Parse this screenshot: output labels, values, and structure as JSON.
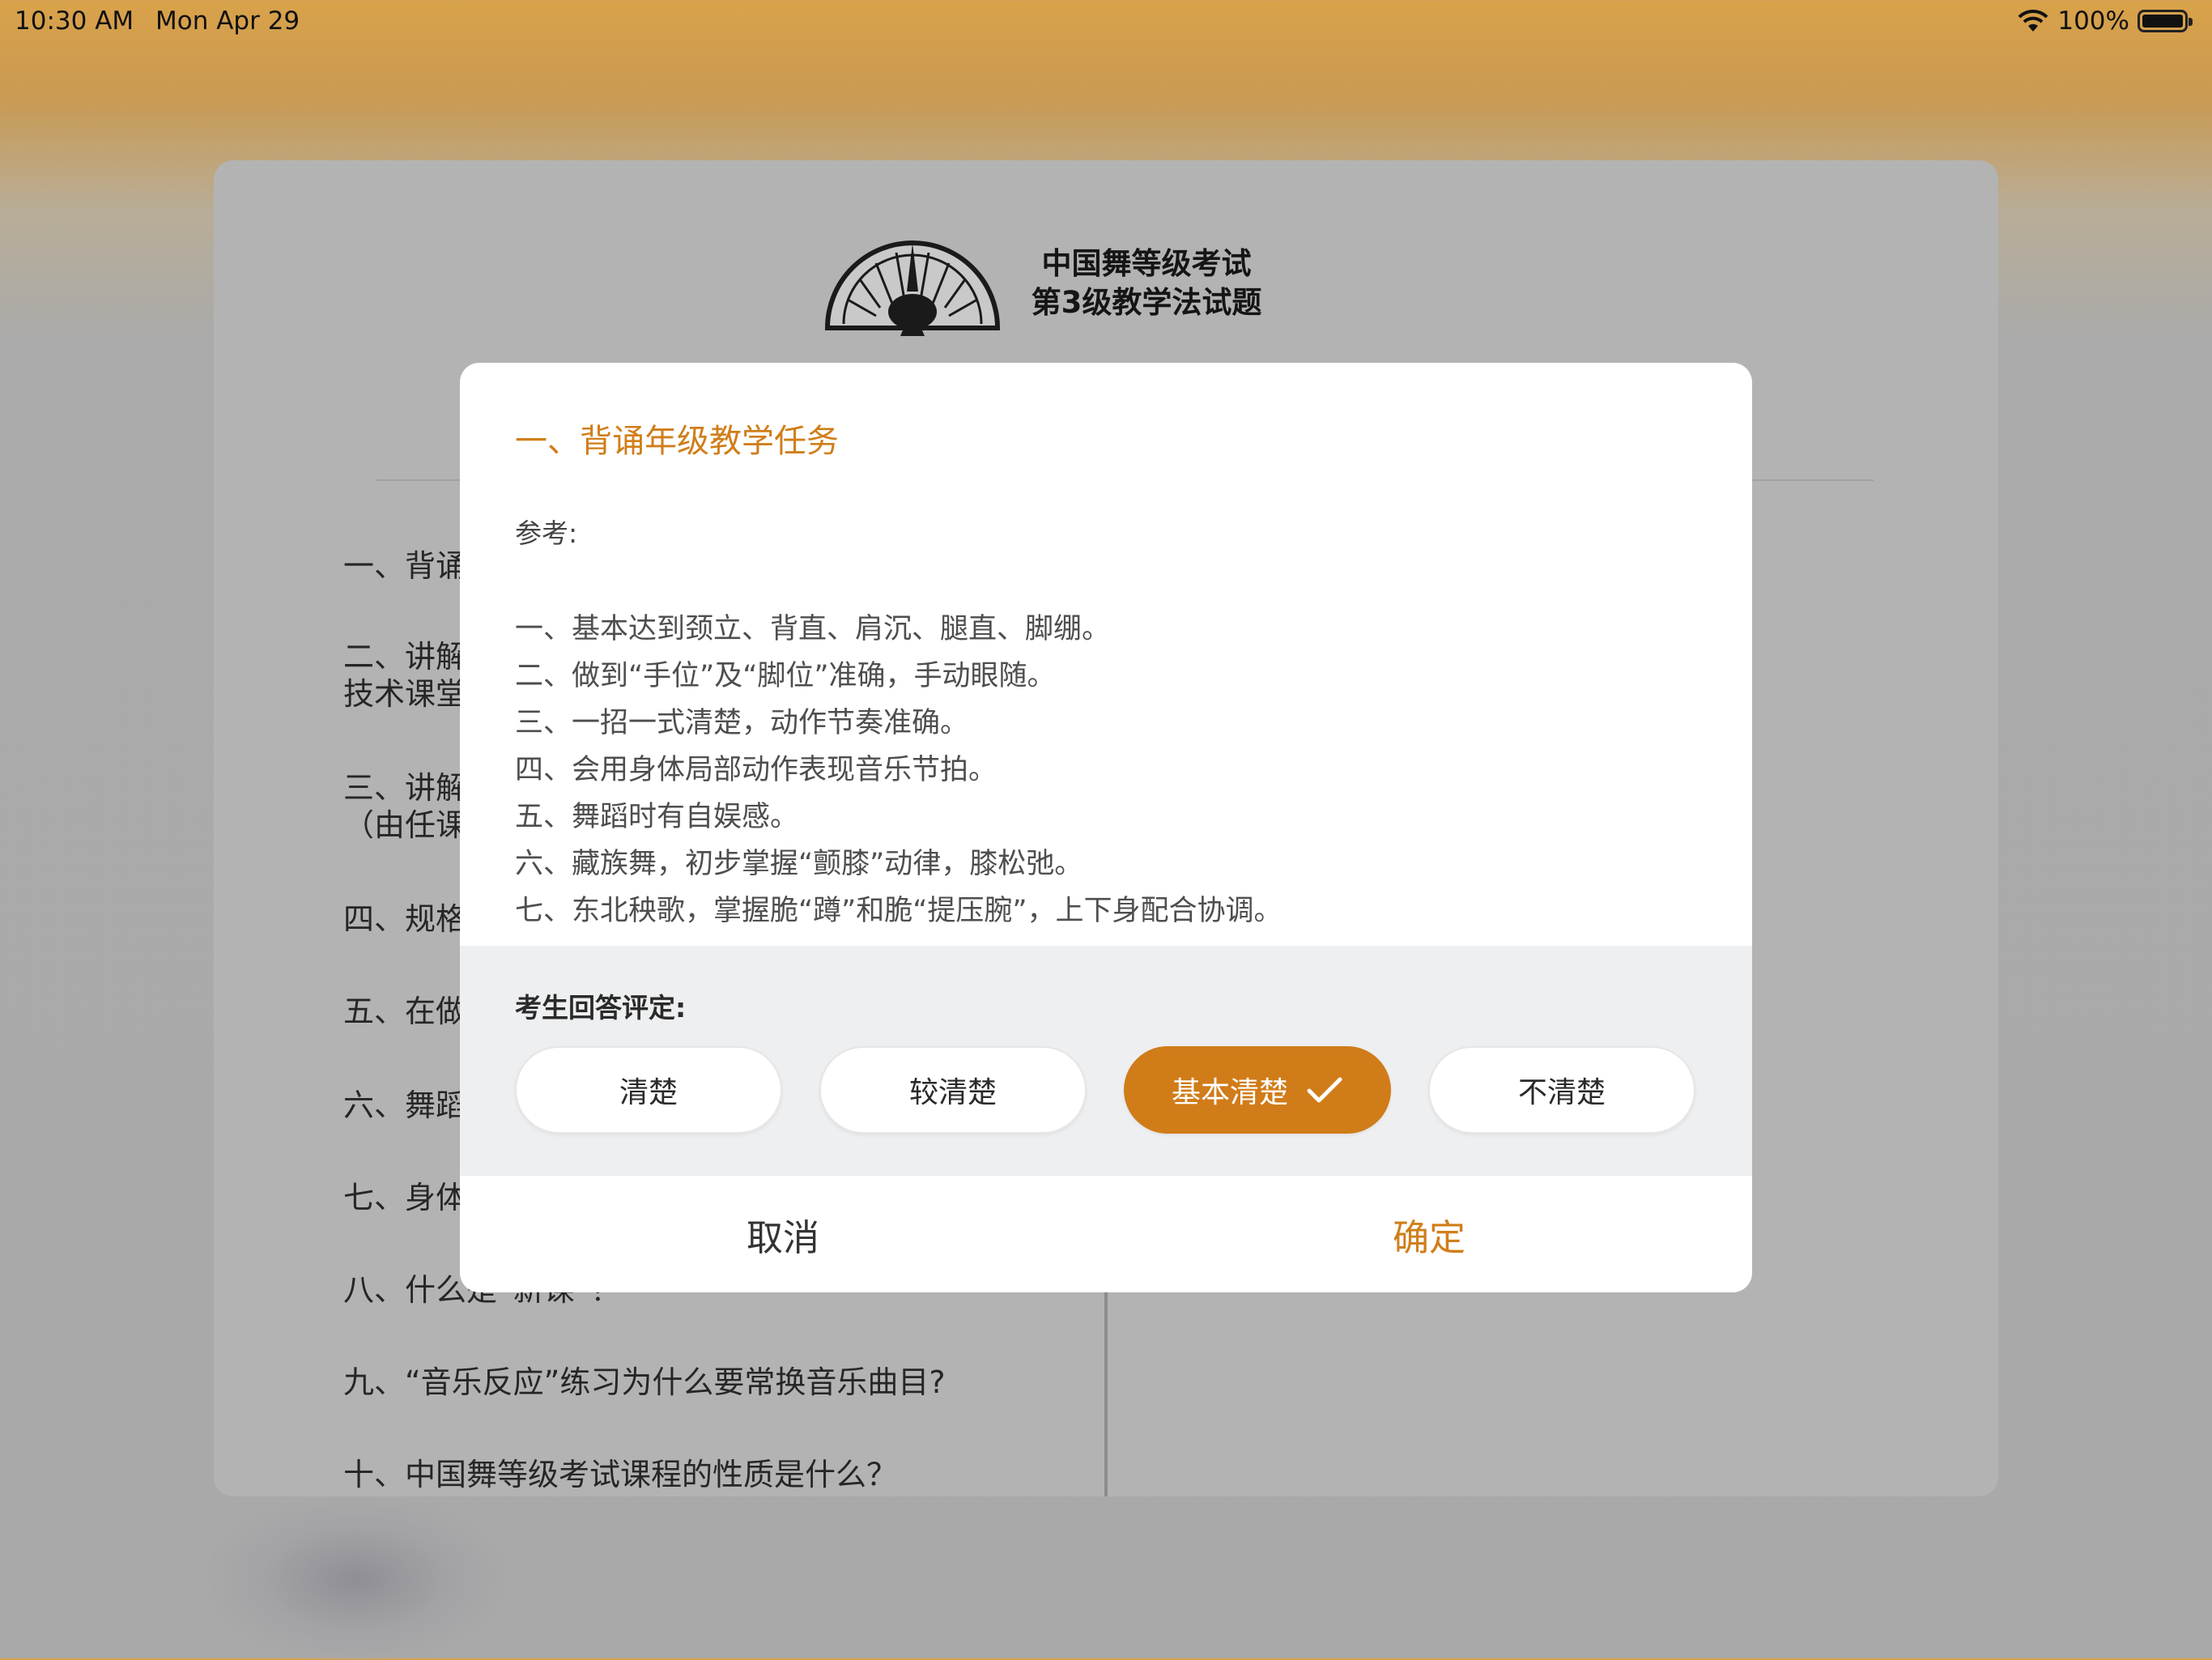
{
  "status_bar": {
    "time": "10:30 AM",
    "date": "Mon Apr 29",
    "battery": "100%"
  },
  "document": {
    "title_line1": "中国舞等级考试",
    "title_line2": "第3级教学法试题",
    "questions": [
      "一、背诵",
      "二、讲解",
      "技术课堂",
      "三、讲解",
      "（由任课",
      "四、规格",
      "五、在做",
      "六、舞蹈",
      "七、身体",
      "八、什么是“新课”？",
      "九、“音乐反应”练习为什么要常换音乐曲目?",
      "十、中国舞等级考试课程的性质是什么？"
    ]
  },
  "dialog": {
    "title": "一、背诵年级教学任务",
    "reference_label": "参考:",
    "reference_lines": [
      "一、基本达到颈立、背直、肩沉、腿直、脚绷。",
      "二、做到“手位”及“脚位”准确，手动眼随。",
      "三、一招一式清楚，动作节奏准确。",
      "四、会用身体局部动作表现音乐节拍。",
      "五、舞蹈时有自娱感。",
      "六、藏族舞，初步掌握“颤膝”动律，膝松弛。",
      "七、东北秧歌，掌握脆“蹲”和脆“提压腕”，上下身配合协调。"
    ],
    "rating_label": "考生回答评定:",
    "rating_options": [
      "清楚",
      "较清楚",
      "基本清楚",
      "不清楚"
    ],
    "selected_option": "基本清楚",
    "cancel_label": "取消",
    "confirm_label": "确定"
  },
  "colors": {
    "accent": "#d07c19",
    "panel": "#eeeff1",
    "overlay": "#b3b3b3"
  },
  "icons": {
    "wifi": "wifi-icon",
    "battery": "battery-icon",
    "check": "checkmark-icon"
  }
}
